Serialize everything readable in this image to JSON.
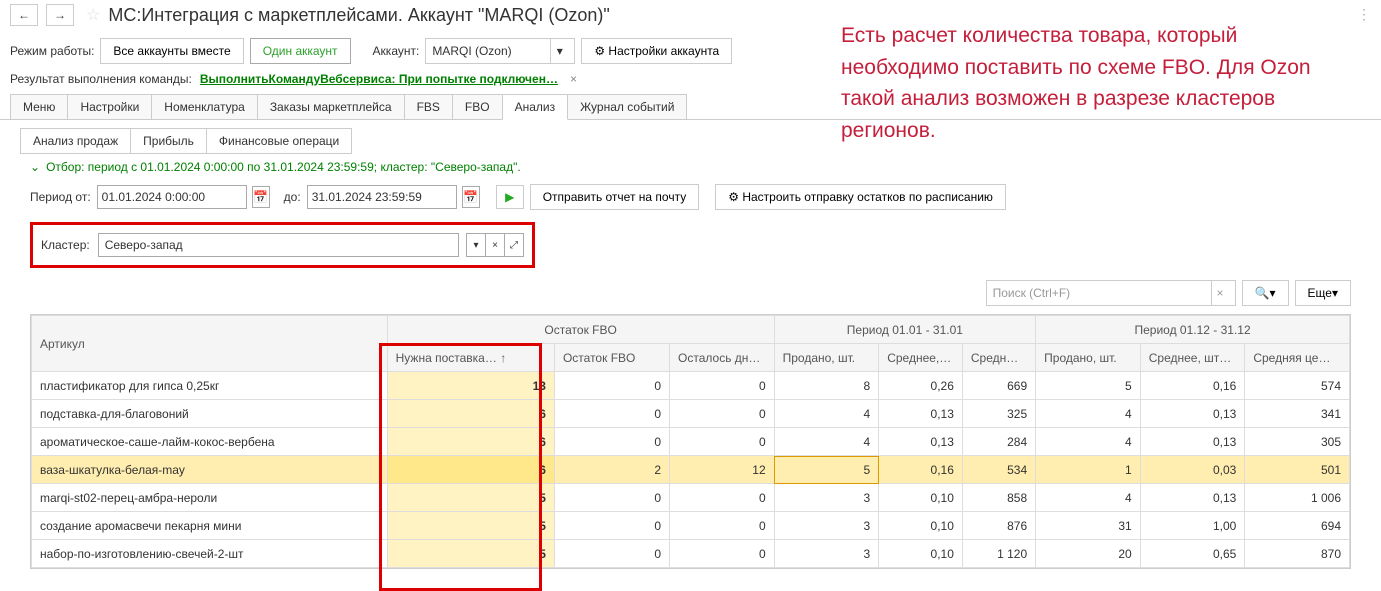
{
  "window": {
    "title": "МС:Интеграция с маркетплейсами. Аккаунт \"MARQI (Ozon)\""
  },
  "toolbar": {
    "mode_label": "Режим работы:",
    "all_accounts": "Все аккаунты вместе",
    "one_account": "Один аккаунт",
    "account_label": "Аккаунт:",
    "account_value": "MARQI (Ozon)",
    "account_settings": "Настройки аккаунта"
  },
  "result": {
    "label": "Результат выполнения команды:",
    "link": "ВыполнитьКомандуВебсервиса: При попытке подключен…"
  },
  "tabs": {
    "items": [
      "Меню",
      "Настройки",
      "Номенклатура",
      "Заказы маркетплейса",
      "FBS",
      "FBO",
      "Анализ",
      "Журнал событий"
    ],
    "active": 6
  },
  "subtabs": {
    "items": [
      "Анализ продаж",
      "Прибыль",
      "Финансовые операци"
    ],
    "active": 0
  },
  "filter": {
    "text": "Отбор: период с 01.01.2024 0:00:00 по 31.01.2024 23:59:59; кластер: \"Северо-запад\"."
  },
  "period": {
    "from_label": "Период от:",
    "from_value": "01.01.2024  0:00:00",
    "to_label": "до:",
    "to_value": "31.01.2024 23:59:59",
    "send_report": "Отправить отчет на почту",
    "configure": "Настроить отправку остатков по расписанию"
  },
  "cluster": {
    "label": "Кластер:",
    "value": "Северо-запад"
  },
  "search": {
    "placeholder": "Поиск (Ctrl+F)",
    "more": "Еще"
  },
  "table": {
    "header_groups": [
      "",
      "Остаток FBO",
      "Период 01.01 - 31.01",
      "Период 01.12 - 31.12"
    ],
    "headers": {
      "article": "Артикул",
      "supply": "Нужна поставка…",
      "fbo_rest": "Остаток FBO",
      "days_left": "Осталось дн…",
      "sold1": "Продано, шт.",
      "avg1": "Среднее,…",
      "avgp1": "Средн…",
      "sold2": "Продано, шт.",
      "avg2": "Среднее, шт…",
      "avgp2": "Средняя це…"
    },
    "rows": [
      {
        "article": "пластификатор для гипса 0,25кг",
        "supply": "13",
        "fbo": "0",
        "days": "0",
        "s1": "8",
        "a1": "0,26",
        "p1": "669",
        "s2": "5",
        "a2": "0,16",
        "p2": "574",
        "hl": false
      },
      {
        "article": "подставка-для-благовоний",
        "supply": "6",
        "fbo": "0",
        "days": "0",
        "s1": "4",
        "a1": "0,13",
        "p1": "325",
        "s2": "4",
        "a2": "0,13",
        "p2": "341",
        "hl": false
      },
      {
        "article": "ароматическое-саше-лайм-кокос-вербена",
        "supply": "6",
        "fbo": "0",
        "days": "0",
        "s1": "4",
        "a1": "0,13",
        "p1": "284",
        "s2": "4",
        "a2": "0,13",
        "p2": "305",
        "hl": false
      },
      {
        "article": "ваза-шкатулка-белая-may",
        "supply": "6",
        "fbo": "2",
        "days": "12",
        "s1": "5",
        "a1": "0,16",
        "p1": "534",
        "s2": "1",
        "a2": "0,03",
        "p2": "501",
        "hl": true
      },
      {
        "article": "marqi-st02-перец-амбра-нероли",
        "supply": "5",
        "fbo": "0",
        "days": "0",
        "s1": "3",
        "a1": "0,10",
        "p1": "858",
        "s2": "4",
        "a2": "0,13",
        "p2": "1 006",
        "hl": false
      },
      {
        "article": "создание аромасвечи пекарня мини",
        "supply": "5",
        "fbo": "0",
        "days": "0",
        "s1": "3",
        "a1": "0,10",
        "p1": "876",
        "s2": "31",
        "a2": "1,00",
        "p2": "694",
        "hl": false
      },
      {
        "article": "набор-по-изготовлению-свечей-2-шт",
        "supply": "5",
        "fbo": "0",
        "days": "0",
        "s1": "3",
        "a1": "0,10",
        "p1": "1 120",
        "s2": "20",
        "a2": "0,65",
        "p2": "870",
        "hl": false
      }
    ]
  },
  "annotation": "Есть расчет количества товара, который необходимо поставить по схеме FBO. Для Ozon такой анализ возможен в разрезе кластеров регионов."
}
